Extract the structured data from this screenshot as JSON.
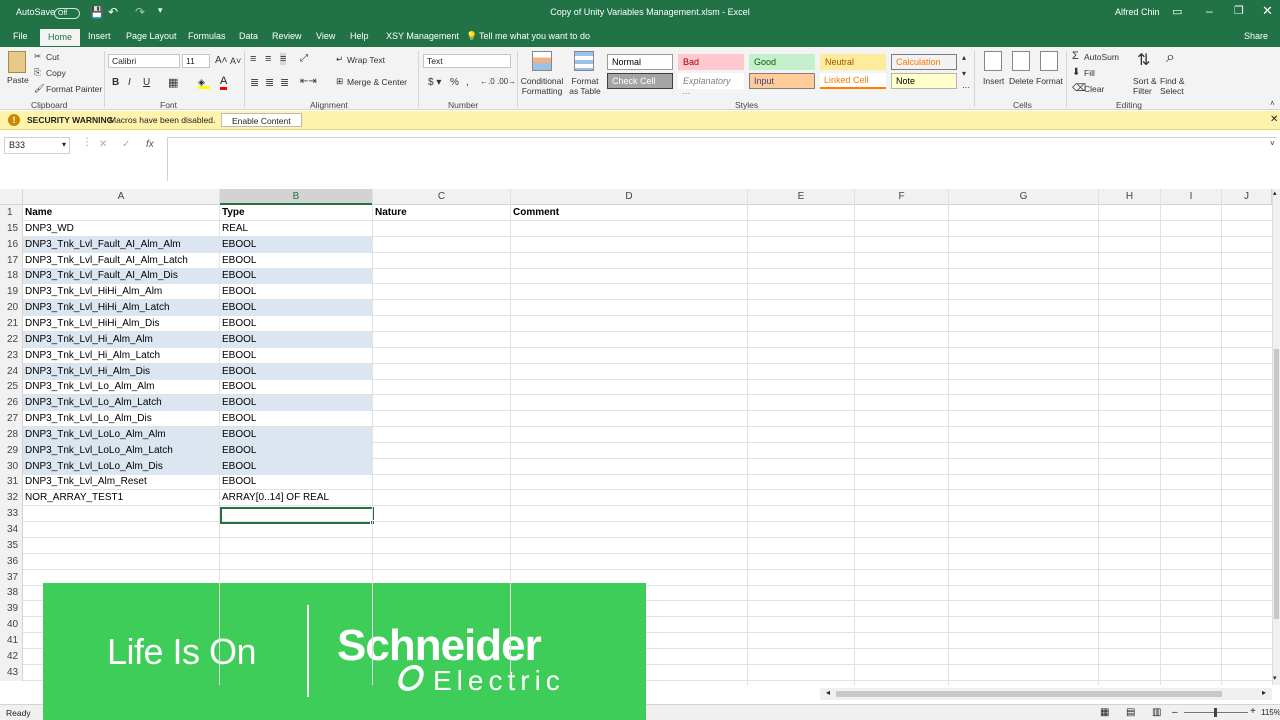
{
  "window": {
    "autosave_label": "AutoSave",
    "autosave_state": "Off",
    "title": "Copy of Unity Variables Management.xlsm  -  Excel",
    "user": "Alfred Chin",
    "share": "Share"
  },
  "tabs": [
    "File",
    "Home",
    "Insert",
    "Page Layout",
    "Formulas",
    "Data",
    "Review",
    "View",
    "Help",
    "XSY Management"
  ],
  "tell_me": "Tell me what you want to do",
  "ribbon": {
    "clipboard": {
      "paste": "Paste",
      "cut": "Cut",
      "copy": "Copy",
      "format_painter": "Format Painter",
      "group": "Clipboard"
    },
    "font": {
      "name": "Calibri",
      "size": "11",
      "group": "Font",
      "bold": "B",
      "italic": "I",
      "underline": "U"
    },
    "alignment": {
      "wrap": "Wrap Text",
      "merge": "Merge & Center",
      "group": "Alignment"
    },
    "number": {
      "format": "Text",
      "group": "Number"
    },
    "styles": {
      "conditional": "Conditional Formatting",
      "format_as_table": "Format as Table",
      "group": "Styles",
      "gallery": [
        {
          "label": "Normal",
          "bg": "#ffffff",
          "fg": "#000000",
          "border": "#9a9a9a"
        },
        {
          "label": "Bad",
          "bg": "#ffc7ce",
          "fg": "#9c0006",
          "border": "#ffc7ce"
        },
        {
          "label": "Good",
          "bg": "#c6efce",
          "fg": "#006100",
          "border": "#c6efce"
        },
        {
          "label": "Neutral",
          "bg": "#ffeb9c",
          "fg": "#9c5700",
          "border": "#ffeb9c"
        },
        {
          "label": "Calculation",
          "bg": "#f2f2f2",
          "fg": "#fa7d00",
          "border": "#7f7f7f"
        },
        {
          "label": "Check Cell",
          "bg": "#a5a5a5",
          "fg": "#ffffff",
          "border": "#3f3f3f"
        },
        {
          "label": "Explanatory ...",
          "bg": "#ffffff",
          "fg": "#7f7f7f",
          "border": "#ffffff"
        },
        {
          "label": "Input",
          "bg": "#ffcc99",
          "fg": "#3f3f76",
          "border": "#7f7f7f"
        },
        {
          "label": "Linked Cell",
          "bg": "#ffffff",
          "fg": "#fa7d00",
          "border": "#ff8001"
        },
        {
          "label": "Note",
          "bg": "#ffffcc",
          "fg": "#000000",
          "border": "#b2b2b2"
        }
      ]
    },
    "cells": {
      "insert": "Insert",
      "delete": "Delete",
      "format": "Format",
      "group": "Cells"
    },
    "editing": {
      "autosum": "AutoSum",
      "fill": "Fill",
      "clear": "Clear",
      "sort": "Sort & Filter",
      "find": "Find & Select",
      "group": "Editing"
    }
  },
  "security": {
    "title": "SECURITY WARNING",
    "message": "Macros have been disabled.",
    "button": "Enable Content"
  },
  "formula_bar": {
    "name_box": "B33",
    "value": ""
  },
  "columns": [
    "A",
    "B",
    "C",
    "D",
    "E",
    "F",
    "G",
    "H",
    "I",
    "J"
  ],
  "header_row": {
    "num": "1",
    "a": "Name",
    "b": "Type",
    "c": "Nature",
    "d": "Comment"
  },
  "rows": [
    {
      "num": "15",
      "a": "DNP3_WD",
      "b": "REAL"
    },
    {
      "num": "16",
      "a": "DNP3_Tnk_Lvl_Fault_AI_Alm_Alm",
      "b": "EBOOL"
    },
    {
      "num": "17",
      "a": "DNP3_Tnk_Lvl_Fault_AI_Alm_Latch",
      "b": "EBOOL"
    },
    {
      "num": "18",
      "a": "DNP3_Tnk_Lvl_Fault_AI_Alm_Dis",
      "b": "EBOOL"
    },
    {
      "num": "19",
      "a": "DNP3_Tnk_Lvl_HiHi_Alm_Alm",
      "b": "EBOOL"
    },
    {
      "num": "20",
      "a": "DNP3_Tnk_Lvl_HiHi_Alm_Latch",
      "b": "EBOOL"
    },
    {
      "num": "21",
      "a": "DNP3_Tnk_Lvl_HiHi_Alm_Dis",
      "b": "EBOOL"
    },
    {
      "num": "22",
      "a": "DNP3_Tnk_Lvl_Hi_Alm_Alm",
      "b": "EBOOL"
    },
    {
      "num": "23",
      "a": "DNP3_Tnk_Lvl_Hi_Alm_Latch",
      "b": "EBOOL"
    },
    {
      "num": "24",
      "a": "DNP3_Tnk_Lvl_Hi_Alm_Dis",
      "b": "EBOOL"
    },
    {
      "num": "25",
      "a": "DNP3_Tnk_Lvl_Lo_Alm_Alm",
      "b": "EBOOL"
    },
    {
      "num": "26",
      "a": "DNP3_Tnk_Lvl_Lo_Alm_Latch",
      "b": "EBOOL"
    },
    {
      "num": "27",
      "a": "DNP3_Tnk_Lvl_Lo_Alm_Dis",
      "b": "EBOOL"
    },
    {
      "num": "28",
      "a": "DNP3_Tnk_Lvl_LoLo_Alm_Alm",
      "b": "EBOOL"
    },
    {
      "num": "29",
      "a": "DNP3_Tnk_Lvl_LoLo_Alm_Latch",
      "b": "EBOOL"
    },
    {
      "num": "30",
      "a": "DNP3_Tnk_Lvl_LoLo_Alm_Dis",
      "b": "EBOOL"
    },
    {
      "num": "31",
      "a": "DNP3_Tnk_Lvl_Alm_Reset",
      "b": "EBOOL"
    },
    {
      "num": "32",
      "a": "NOR_ARRAY_TEST1",
      "b": "ARRAY[0..14] OF REAL"
    },
    {
      "num": "33",
      "a": "",
      "b": ""
    },
    {
      "num": "34",
      "a": "",
      "b": ""
    },
    {
      "num": "35",
      "a": "",
      "b": ""
    },
    {
      "num": "36",
      "a": "",
      "b": ""
    },
    {
      "num": "37",
      "a": "",
      "b": ""
    },
    {
      "num": "38",
      "a": "",
      "b": ""
    },
    {
      "num": "39",
      "a": "",
      "b": ""
    },
    {
      "num": "40",
      "a": "",
      "b": ""
    },
    {
      "num": "41",
      "a": "",
      "b": ""
    },
    {
      "num": "42",
      "a": "",
      "b": ""
    },
    {
      "num": "43",
      "a": "",
      "b": ""
    }
  ],
  "highlighted_rows": [
    "16",
    "18",
    "20",
    "22",
    "24",
    "26",
    "28",
    "29",
    "30"
  ],
  "selected_cell": "B33",
  "status": {
    "ready": "Ready",
    "zoom": "115%"
  },
  "brand": {
    "tagline": "Life Is On",
    "company_1": "Schneider",
    "company_2": "Electric",
    "color": "#3dcd58"
  },
  "colors": {
    "excel_green": "#217346",
    "highlight": "#dce6f1"
  }
}
